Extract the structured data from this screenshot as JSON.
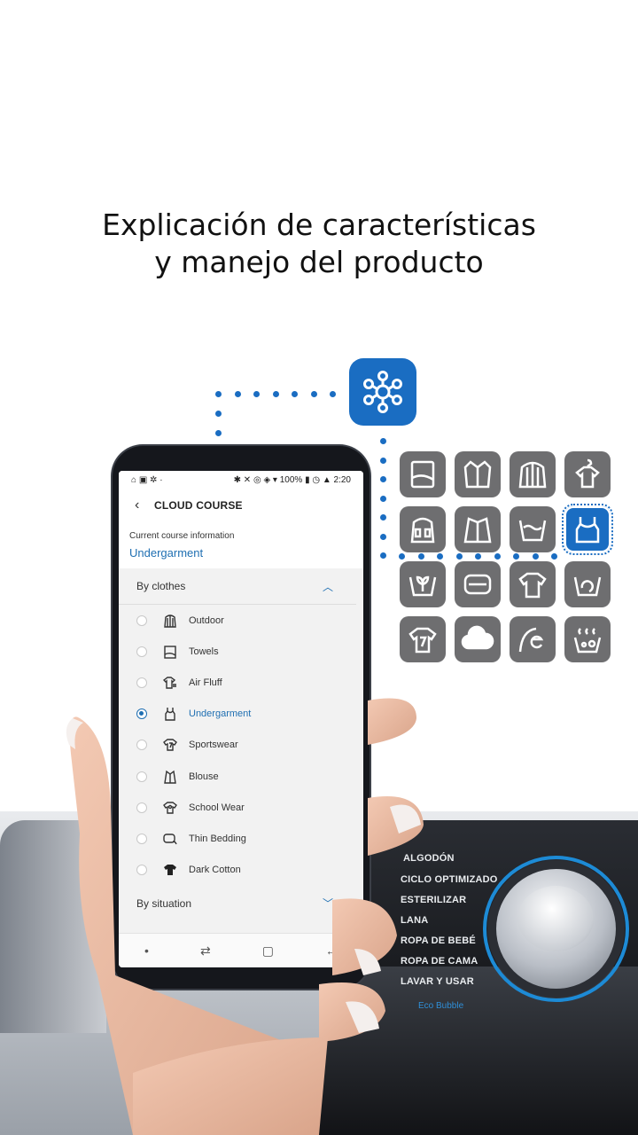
{
  "headline": {
    "line1": "Explicación de características",
    "line2": "y manejo del producto"
  },
  "status_bar": {
    "left": "⌂ ▣ ✲ ·",
    "right": "✱ ✕ ◎ ◈ ▾ 100% ▮ ◷ ▲ 2:20"
  },
  "app": {
    "title": "CLOUD COURSE",
    "current_label": "Current course information",
    "current_value": "Undergarment",
    "section_clothes": "By clothes",
    "section_situation": "By situation",
    "accent": "#1f6fb2"
  },
  "courses": [
    {
      "label": "Outdoor",
      "icon": "jacket-icon",
      "selected": false
    },
    {
      "label": "Towels",
      "icon": "towel-icon",
      "selected": false
    },
    {
      "label": "Air Fluff",
      "icon": "shirt-air-icon",
      "selected": false
    },
    {
      "label": "Undergarment",
      "icon": "tank-top-icon",
      "selected": true
    },
    {
      "label": "Sportswear",
      "icon": "sports-shirt-icon",
      "selected": false
    },
    {
      "label": "Blouse",
      "icon": "blouse-icon",
      "selected": false
    },
    {
      "label": "School Wear",
      "icon": "uniform-icon",
      "selected": false
    },
    {
      "label": "Thin Bedding",
      "icon": "bedding-icon",
      "selected": false
    },
    {
      "label": "Dark Cotton",
      "icon": "dark-shirt-icon",
      "selected": false
    }
  ],
  "washer_courses": [
    "ALGODÓN",
    "CICLO OPTIMIZADO",
    "ESTERILIZAR",
    "LANA",
    "ROPA DE BEBÉ",
    "ROPA DE CAMA",
    "LAVAR Y USAR"
  ],
  "washer_brand": "Eco Bubble",
  "colors": {
    "brand_blue": "#1a6dc2",
    "icon_gray": "#6e6e70"
  }
}
